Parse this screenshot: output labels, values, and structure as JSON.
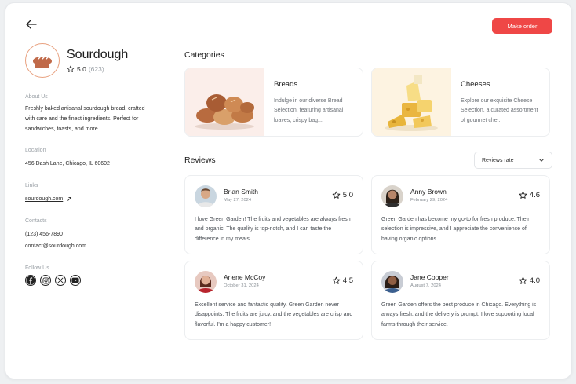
{
  "header": {
    "make_order_label": "Make order"
  },
  "shop": {
    "name": "Sourdough",
    "rating": "5.0",
    "rating_count": "(623)",
    "about_label": "About Us",
    "about_text": "Freshly baked artisanal sourdough bread, crafted with care and the finest ingredients. Perfect for sandwiches, toasts, and more.",
    "location_label": "Location",
    "location_text": "456 Dash Lane, Chicago, IL 60602",
    "links_label": "Links",
    "link_text": "sourdough.com",
    "contacts_label": "Contacts",
    "phone": "(123) 456-7890",
    "email": "contact@sourdough.com",
    "follow_label": "Follow Us",
    "socials": [
      "facebook-icon",
      "instagram-icon",
      "x-icon",
      "youtube-icon"
    ]
  },
  "categories": {
    "title": "Categories",
    "items": [
      {
        "title": "Breads",
        "desc": "Indulge in our diverse Bread Selection, featuring artisanal loaves, crispy bag..."
      },
      {
        "title": "Cheeses",
        "desc": "Explore our exquisite Cheese Selection, a curated assortment of gourmet che..."
      }
    ]
  },
  "reviews": {
    "title": "Reviews",
    "sort_value": "Reviews rate",
    "items": [
      {
        "name": "Brian Smith",
        "date": "May 27, 2024",
        "rating": "5.0",
        "text": "I love Green Garden! The fruits and vegetables are always fresh and organic. The quality is top-notch, and I can taste the difference in my meals."
      },
      {
        "name": "Anny Brown",
        "date": "February 29, 2024",
        "rating": "4.6",
        "text": "Green Garden has become my go-to for fresh produce. Their selection is impressive, and I appreciate the convenience of having organic options."
      },
      {
        "name": "Arlene McCoy",
        "date": "October 31, 2024",
        "rating": "4.5",
        "text": "Excellent service and fantastic quality. Green Garden never disappoints. The fruits are juicy, and the vegetables are crisp and flavorful. I'm a happy customer!"
      },
      {
        "name": "Jane Cooper",
        "date": "August 7, 2024",
        "rating": "4.0",
        "text": "Green Garden offers the best produce in Chicago. Everything is always fresh, and the delivery is prompt. I love supporting local farms through their service."
      }
    ]
  },
  "colors": {
    "accent": "#ef4746",
    "logo_ring": "#e8a07e",
    "bread": "#c06a4a"
  }
}
